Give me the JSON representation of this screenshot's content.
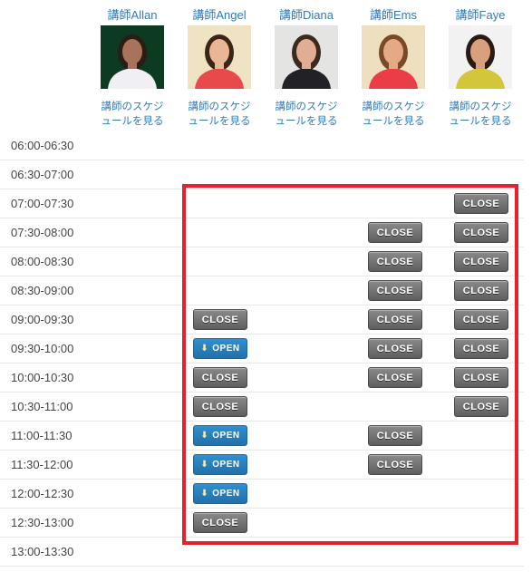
{
  "teachers": [
    {
      "name": "講師Allan",
      "link": "講師のスケジュールを見る",
      "photo_colors": {
        "bg": "#0d3b22",
        "skin": "#a8735a",
        "shirt": "#f0f0f4",
        "hair": "#2a1d15"
      }
    },
    {
      "name": "講師Angel",
      "link": "講師のスケジュールを見る",
      "photo_colors": {
        "bg": "#efe3c4",
        "skin": "#e9b796",
        "shirt": "#e84a4c",
        "hair": "#3a2518"
      }
    },
    {
      "name": "講師Diana",
      "link": "講師のスケジュールを見る",
      "photo_colors": {
        "bg": "#e4e4e2",
        "skin": "#e1ae93",
        "shirt": "#222226",
        "hair": "#3b2a1e"
      }
    },
    {
      "name": "講師Ems",
      "link": "講師のスケジュールを見る",
      "photo_colors": {
        "bg": "#eee0bf",
        "skin": "#e4aa86",
        "shirt": "#ea3d47",
        "hair": "#7a4a28"
      }
    },
    {
      "name": "講師Faye",
      "link": "講師のスケジュールを見る",
      "photo_colors": {
        "bg": "#f2f2f2",
        "skin": "#d9a07e",
        "shirt": "#d4c63a",
        "hair": "#2a1a14"
      }
    }
  ],
  "labels": {
    "close": "CLOSE",
    "open": "OPEN"
  },
  "icons": {
    "open_arrow": "⬇"
  },
  "colors": {
    "highlight_border": "#e5212b",
    "link": "#337ab7",
    "open_btn": "#2a85c4",
    "close_btn": "#6e6e6e"
  },
  "slots": [
    {
      "time": "06:00-06:30",
      "status": [
        null,
        null,
        null,
        null,
        null
      ]
    },
    {
      "time": "06:30-07:00",
      "status": [
        null,
        null,
        null,
        null,
        null
      ]
    },
    {
      "time": "07:00-07:30",
      "status": [
        null,
        null,
        null,
        null,
        "close"
      ]
    },
    {
      "time": "07:30-08:00",
      "status": [
        null,
        null,
        null,
        "close",
        "close"
      ]
    },
    {
      "time": "08:00-08:30",
      "status": [
        null,
        null,
        null,
        "close",
        "close"
      ]
    },
    {
      "time": "08:30-09:00",
      "status": [
        null,
        null,
        null,
        "close",
        "close"
      ]
    },
    {
      "time": "09:00-09:30",
      "status": [
        null,
        "close",
        null,
        "close",
        "close"
      ]
    },
    {
      "time": "09:30-10:00",
      "status": [
        null,
        "open",
        null,
        "close",
        "close"
      ]
    },
    {
      "time": "10:00-10:30",
      "status": [
        null,
        "close",
        null,
        "close",
        "close"
      ]
    },
    {
      "time": "10:30-11:00",
      "status": [
        null,
        "close",
        null,
        null,
        "close"
      ]
    },
    {
      "time": "11:00-11:30",
      "status": [
        null,
        "open",
        null,
        "close",
        null
      ]
    },
    {
      "time": "11:30-12:00",
      "status": [
        null,
        "open",
        null,
        "close",
        null
      ]
    },
    {
      "time": "12:00-12:30",
      "status": [
        null,
        "open",
        null,
        null,
        null
      ]
    },
    {
      "time": "12:30-13:00",
      "status": [
        null,
        "close",
        null,
        null,
        null
      ]
    },
    {
      "time": "13:00-13:30",
      "status": [
        null,
        null,
        null,
        null,
        null
      ]
    }
  ]
}
